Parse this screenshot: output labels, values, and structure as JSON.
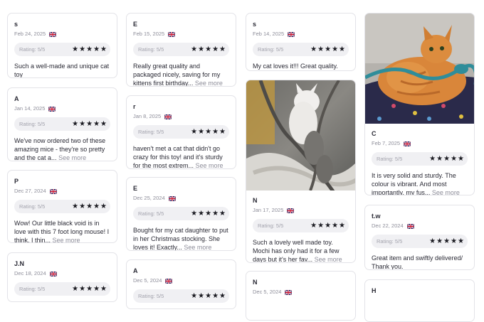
{
  "rating_label": "Rating: 5/5",
  "see_more": "See more",
  "flag_icon": "uk-flag-icon",
  "star_icon": "star-icon",
  "colors": {
    "star": "#1b1b22",
    "pill": "#f0f0f3",
    "border": "#e3e3e8",
    "muted": "#8d8d99"
  },
  "reviews": {
    "c1r1": {
      "name": "s",
      "date": "Feb 24, 2025",
      "text": "Such a well-made and unique cat toy",
      "more": ""
    },
    "c1r2": {
      "name": "A",
      "date": "Jan 14, 2025",
      "text": "We've now ordered two of these amazing mice - they're so pretty and the cat a...",
      "more": "See more"
    },
    "c1r3": {
      "name": "P",
      "date": "Dec 27, 2024",
      "text": "Wow! Our little black void is in love with this 7 foot long mouse! I think, I thin...",
      "more": "See more"
    },
    "c1r4": {
      "name": "J.N",
      "date": "Dec 18, 2024"
    },
    "c2r1": {
      "name": "E",
      "date": "Feb 15, 2025",
      "text": "Really great quality and packaged nicely, saving for my kittens first birthday...",
      "more": "See more"
    },
    "c2r2": {
      "name": "r",
      "date": "Jan 8, 2025",
      "text": "haven't met a cat that didn't go crazy for this toy! and it's sturdy for the most extrem...",
      "more": "See more"
    },
    "c2r3": {
      "name": "E",
      "date": "Dec 25, 2024",
      "text": "Bought for my cat daughter to put in her Christmas stocking. She loves it! Exactly...",
      "more": "See more"
    },
    "c2r4": {
      "name": "A",
      "date": "Dec 5, 2024"
    },
    "c3r1": {
      "name": "s",
      "date": "Feb 14, 2025",
      "text": "My cat loves it!!! Great quality.",
      "more": ""
    },
    "c3r2": {
      "name": "N",
      "date": "Jan 17, 2025",
      "text": "Such a lovely well made toy. Mochi has only had it for a few days but it's her fav...",
      "more": "See more"
    },
    "c3r3": {
      "name": "N",
      "date": "Dec 5, 2024"
    },
    "c4r1": {
      "name": "C",
      "date": "Feb 7, 2025",
      "text": "It is very solid and sturdy. The colour is vibrant. And most importantly, my fus...",
      "more": "See more"
    },
    "c4r2": {
      "name": "t.w",
      "date": "Dec 22, 2024",
      "text": "Great item and swiftly delivered/ Thank you.",
      "more": ""
    },
    "c4r3": {
      "name": "H"
    }
  }
}
